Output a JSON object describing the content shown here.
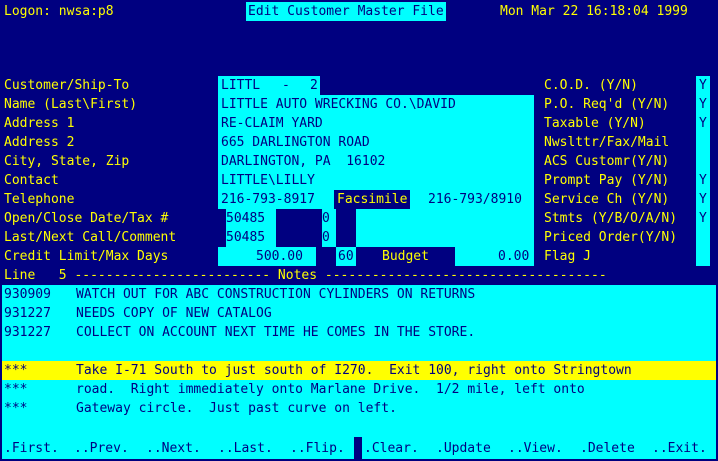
{
  "header": {
    "logon": "Logon: nwsa:p8",
    "title": "Edit Customer Master File",
    "datetime": "Mon Mar 22 16:18:04 1999"
  },
  "form": {
    "labels": {
      "customer_ship_to": "Customer/Ship-To",
      "name": "Name (Last\\First)",
      "address1": "Address 1",
      "address2": "Address 2",
      "city_state_zip": "City, State, Zip",
      "contact": "Contact",
      "telephone": "Telephone",
      "open_close": "Open/Close Date/Tax #",
      "last_next_call": "Last/Next Call/Comment",
      "credit_limit": "Credit Limit/Max Days",
      "facsimile": "Facsimile",
      "budget": "Budget"
    },
    "values": {
      "customer": "LITTL",
      "dash": "-",
      "ship_to": "2",
      "name": "LITTLE AUTO WRECKING CO.\\DAVID",
      "address1": "RE-CLAIM YARD",
      "address2": "665 DARLINGTON ROAD",
      "city_state_zip": "DARLINGTON, PA  16102",
      "contact": "LITTLE\\LILLY",
      "telephone": "216-793-8917",
      "facsimile": "216-793/8910",
      "open_date": "50485",
      "close_date": "0",
      "last_call": "50485",
      "next_call": "0",
      "credit_limit": "500.00",
      "max_days": "60",
      "budget": "0.00"
    }
  },
  "flags": {
    "labels": {
      "cod": "C.O.D. (Y/N)",
      "po_reqd": "P.O. Req'd (Y/N)",
      "taxable": "Taxable (Y/N)",
      "nwsltr": "Nwslttr/Fax/Mail",
      "acs": "ACS Customr(Y/N)",
      "prompt_pay": "Prompt Pay (Y/N)",
      "service_ch": "Service Ch (Y/N)",
      "stmts": "Stmts (Y/B/O/A/N)",
      "priced_order": "Priced Order(Y/N)",
      "flag": "Flag J"
    },
    "values": {
      "cod": "Y",
      "po_reqd": "Y",
      "taxable": "Y",
      "prompt_pay": "Y",
      "service_ch": "Y",
      "stmts": "Y"
    }
  },
  "notes": {
    "divider": "Line   5 ------------------------- Notes ------------------------------------",
    "rows": [
      {
        "date": "930909",
        "text": "WATCH OUT FOR ABC CONSTRUCTION CYLINDERS ON RETURNS"
      },
      {
        "date": "931227",
        "text": "NEEDS COPY OF NEW CATALOG"
      },
      {
        "date": "931227",
        "text": "COLLECT ON ACCOUNT NEXT TIME HE COMES IN THE STORE."
      }
    ],
    "directions": [
      {
        "mark": "***",
        "text": "Take I-71 South to just south of I270.  Exit 100, right onto Stringtown"
      },
      {
        "mark": "***",
        "text": "road.  Right immediately onto Marlane Drive.  1/2 mile, left onto"
      },
      {
        "mark": "***",
        "text": "Gateway circle.  Just past curve on left."
      }
    ]
  },
  "menu": {
    "first": ".First.",
    "prev": "..Prev.",
    "next": "..Next.",
    "last": "..Last.",
    "flip": "..Flip.",
    "clear": ".Clear.",
    "update": ".Update",
    "view": "..View.",
    "delete": ".Delete",
    "exit": "..Exit."
  },
  "colors": {
    "background": "#000080",
    "field": "#00ffff",
    "label": "#ffff00",
    "highlight": "#ffff00"
  }
}
